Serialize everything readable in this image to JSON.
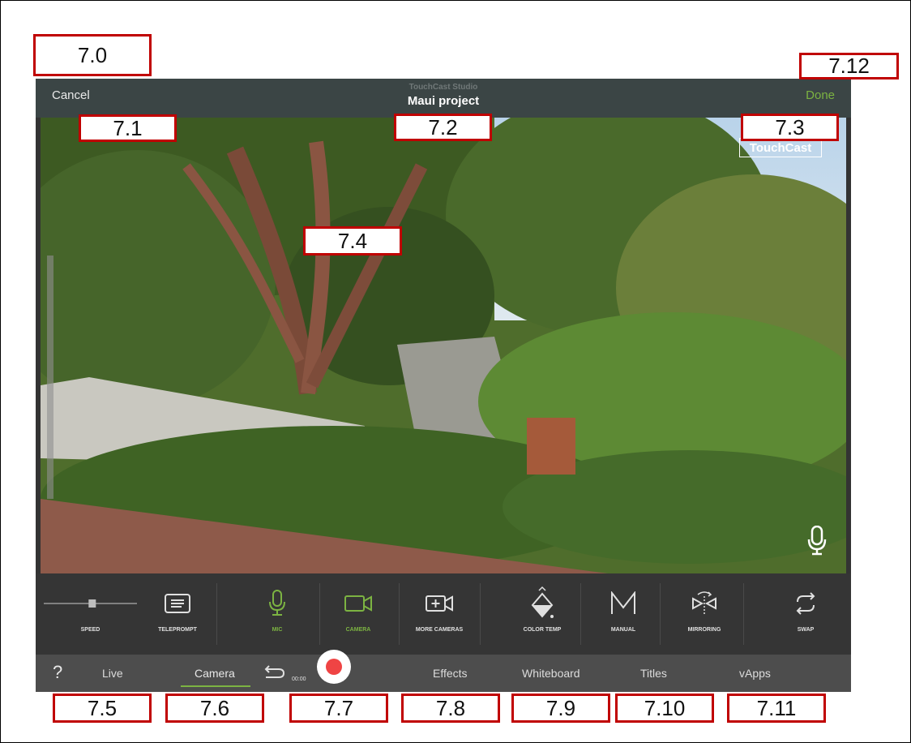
{
  "header": {
    "cancel_label": "Cancel",
    "app_subtitle": "TouchCast Studio",
    "project_title": "Maui project",
    "done_label": "Done"
  },
  "viewport": {
    "watermark": "TouchCast"
  },
  "toolbar": {
    "speed_label": "SPEED",
    "teleprompt_label": "TELEPROMPT",
    "mic_label": "MIC",
    "camera_label": "CAMERA",
    "more_cameras_label": "MORE CAMERAS",
    "color_temp_label": "COLOR TEMP",
    "manual_label": "MANUAL",
    "mirroring_label": "MIRRORING",
    "swap_label": "SWAP",
    "speed_value": 0.52
  },
  "tabs": {
    "help": "?",
    "live": "Live",
    "camera": "Camera",
    "timer": "00:00",
    "effects": "Effects",
    "whiteboard": "Whiteboard",
    "titles": "Titles",
    "vapps": "vApps"
  },
  "callouts": {
    "c0": "7.0",
    "c1": "7.1",
    "c2": "7.2",
    "c3": "7.3",
    "c4": "7.4",
    "c5": "7.5",
    "c6": "7.6",
    "c7": "7.7",
    "c8": "7.8",
    "c9": "7.9",
    "c10": "7.10",
    "c11": "7.11",
    "c12": "7.12"
  },
  "colors": {
    "accent_green": "#7cb342",
    "record_red": "#ef4444",
    "callout_border": "#c00000"
  }
}
